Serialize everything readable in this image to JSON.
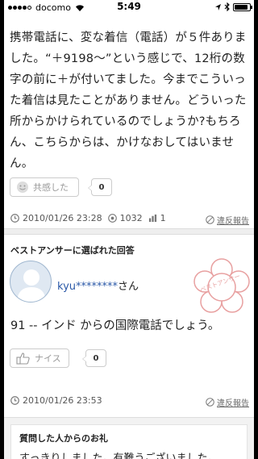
{
  "status_bar": {
    "carrier": "docomo",
    "time": "5:49",
    "signal_bars_filled": 4,
    "signal_bars_total": 5
  },
  "question": {
    "text": "携帯電話に、変な着信（電話）が５件ありました。“＋9198〜”という感じで、12桁の数字の前に＋が付いてました。今までこういった着信は見たことがありません。どういった所からかけられているのでしょうか?もちろん、こちらからは、かけなおしてはいません。",
    "empathy_label": "共感した",
    "empathy_count": "0",
    "date": "2010/01/26 23:28",
    "views": "1032",
    "answers": "1",
    "report_label": "違反報告"
  },
  "best_answer": {
    "section_title": "ベストアンサーに選ばれた回答",
    "username": "kyu********",
    "honorific": "さん",
    "stamp_text": "ベストアンサー",
    "text": "91 -- インド からの国際電話でしょう。",
    "nice_label": "ナイス",
    "nice_count": "0",
    "date": "2010/01/26 23:53",
    "report_label": "違反報告"
  },
  "thanks": {
    "title": "質問した人からのお礼",
    "text": "すっきりしました。有難うございました。"
  },
  "colors": {
    "link_blue": "#2a58a7",
    "stamp_red": "#e8a0a0",
    "avatar_blue": "#9fb6cf"
  }
}
